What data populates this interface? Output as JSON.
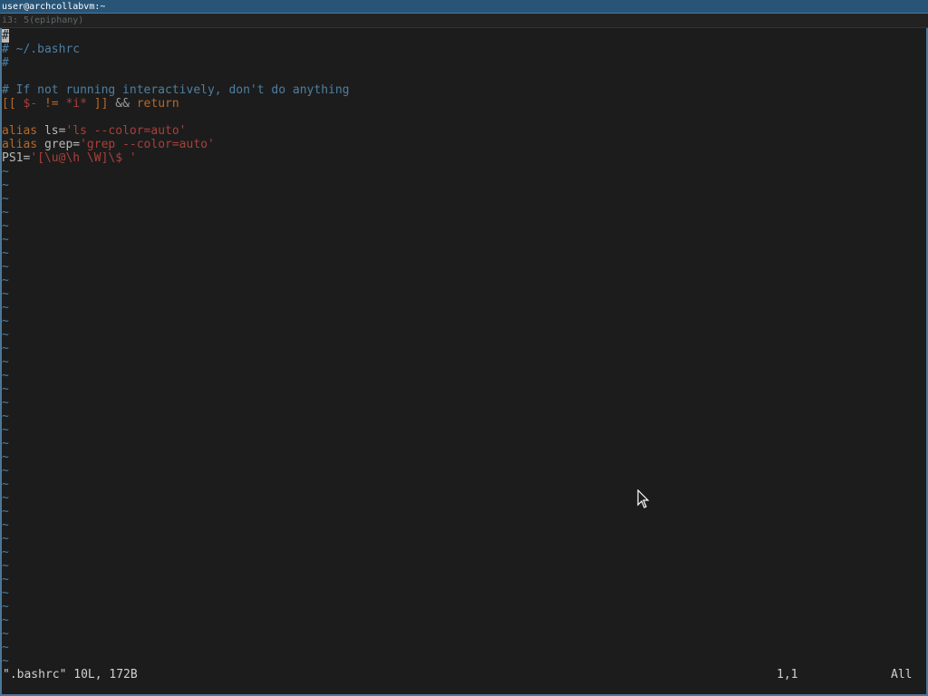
{
  "window": {
    "title": "user@archcollabvm:~",
    "workspace_tab": "i3: 5(epiphany)"
  },
  "editor": {
    "lines": [
      {
        "segments": [
          {
            "text": "#",
            "cls": "cursor"
          }
        ]
      },
      {
        "segments": [
          {
            "text": "# ~/.bashrc",
            "cls": "c-comment"
          }
        ]
      },
      {
        "segments": [
          {
            "text": "#",
            "cls": "c-comment"
          }
        ]
      },
      {
        "segments": [
          {
            "text": "",
            "cls": "c-plain"
          }
        ]
      },
      {
        "segments": [
          {
            "text": "# If not running interactively, don't do anything",
            "cls": "c-comment"
          }
        ]
      },
      {
        "segments": [
          {
            "text": "[[ ",
            "cls": "c-bracket"
          },
          {
            "text": "$-",
            "cls": "c-var"
          },
          {
            "text": " != ",
            "cls": "c-bracket"
          },
          {
            "text": "*i*",
            "cls": "c-string"
          },
          {
            "text": " ]] ",
            "cls": "c-bracket"
          },
          {
            "text": "&&",
            "cls": "c-op"
          },
          {
            "text": " return",
            "cls": "c-keyword"
          }
        ]
      },
      {
        "segments": [
          {
            "text": "",
            "cls": "c-plain"
          }
        ]
      },
      {
        "segments": [
          {
            "text": "alias",
            "cls": "c-keyword"
          },
          {
            "text": " ls=",
            "cls": "c-plain"
          },
          {
            "text": "'ls --color=auto'",
            "cls": "c-string"
          }
        ]
      },
      {
        "segments": [
          {
            "text": "alias",
            "cls": "c-keyword"
          },
          {
            "text": " grep=",
            "cls": "c-plain"
          },
          {
            "text": "'grep --color=auto'",
            "cls": "c-string"
          }
        ]
      },
      {
        "segments": [
          {
            "text": "PS1=",
            "cls": "c-plain"
          },
          {
            "text": "'[\\u@\\h \\W]\\$ '",
            "cls": "c-string"
          }
        ]
      }
    ],
    "tilde_char": "~",
    "tilde_count": 37
  },
  "status": {
    "file_info": "\".bashrc\" 10L, 172B",
    "cursor_position": "1,1",
    "scroll_position": "All"
  },
  "colors": {
    "comment": "#4e7fa0",
    "string": "#a8403a",
    "keyword": "#b36a2e",
    "background": "#1c1c1c",
    "titlebar": "#285577"
  }
}
